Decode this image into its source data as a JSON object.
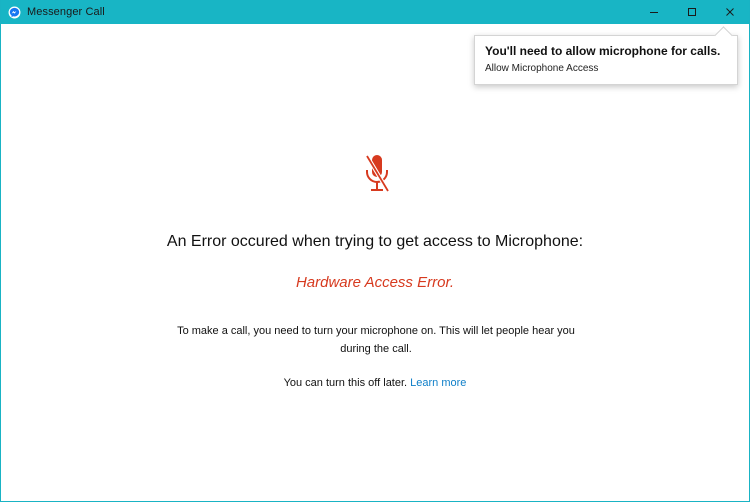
{
  "window": {
    "title": "Messenger Call",
    "accent_color": "#18b5c5"
  },
  "icons": {
    "app": "messenger-icon",
    "minimize": "minimize-icon",
    "maximize": "maximize-icon",
    "close": "close-icon",
    "mic": "microphone-muted-icon"
  },
  "toast": {
    "title": "You'll need to allow microphone for calls.",
    "action_label": "Allow Microphone Access"
  },
  "main": {
    "heading": "An Error occured when trying to get access to Microphone:",
    "error": "Hardware Access Error.",
    "error_color": "#d73a1f",
    "description": "To make a call, you need to turn your microphone on. This will let people hear you during the call.",
    "note_prefix": "You can turn this off later.",
    "learn_more_label": "Learn more",
    "link_color": "#0f7fc8"
  }
}
